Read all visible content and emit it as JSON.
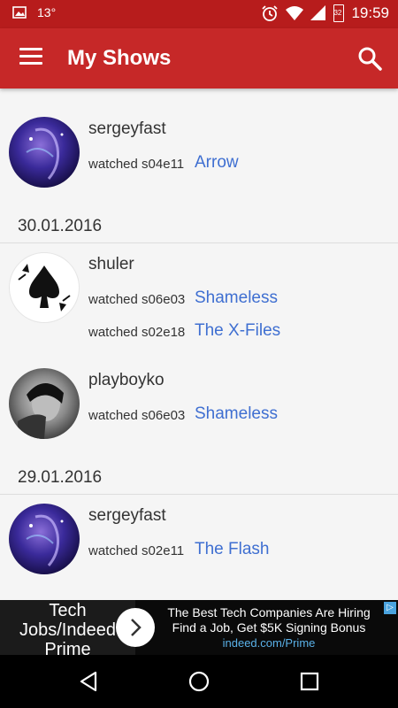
{
  "status_bar": {
    "temperature": "13°",
    "battery": "32",
    "time": "19:59"
  },
  "app_bar": {
    "title": "My Shows"
  },
  "feed": {
    "item1": {
      "user": "sergeyfast",
      "watched": "watched s04e11",
      "show": "Arrow"
    },
    "date1": "30.01.2016",
    "item2": {
      "user": "shuler",
      "entries": [
        {
          "watched": "watched s06e03",
          "show": "Shameless"
        },
        {
          "watched": "watched s02e18",
          "show": "The X-Files"
        }
      ]
    },
    "item3": {
      "user": "playboyko",
      "watched": "watched s06e03",
      "show": "Shameless"
    },
    "date2": "29.01.2016",
    "item4": {
      "user": "sergeyfast",
      "watched": "watched s02e11",
      "show": "The Flash"
    }
  },
  "ad": {
    "left_text_1": "Tech",
    "left_text_2": "Jobs/Indeed",
    "left_text_3": "Prime",
    "headline": "The Best Tech Companies Are Hiring",
    "subline": "Find a Job, Get $5K Signing Bonus",
    "url": "indeed.com/Prime"
  },
  "colors": {
    "status_bar": "#b71c1c",
    "app_bar": "#c62828",
    "link": "#3f6fd1"
  }
}
